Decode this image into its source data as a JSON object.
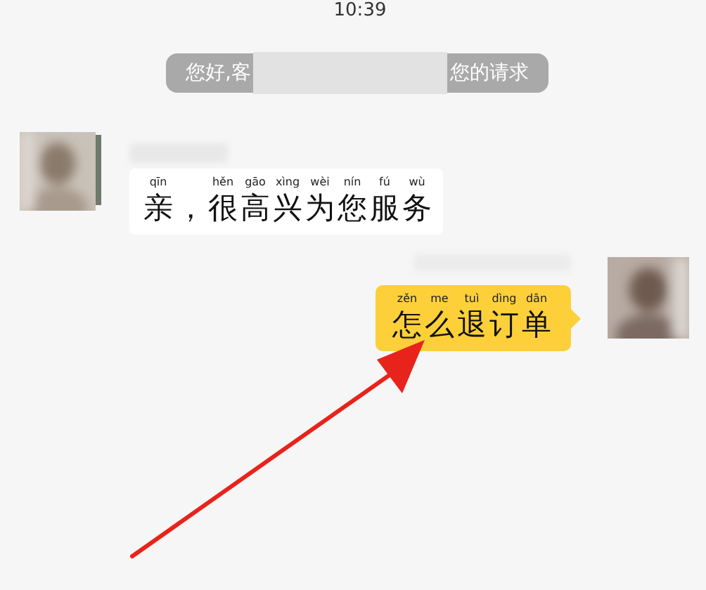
{
  "time": "10:39",
  "notice": {
    "parts": [
      "您好,客",
      "您的请求"
    ]
  },
  "messages": [
    {
      "kind": "received",
      "tokens": [
        {
          "char": "亲",
          "pinyin": "qīn"
        },
        {
          "char": "，"
        },
        {
          "char": "很",
          "pinyin": "hěn"
        },
        {
          "char": "高",
          "pinyin": "gāo"
        },
        {
          "char": "兴",
          "pinyin": "xìng"
        },
        {
          "char": "为",
          "pinyin": "wèi"
        },
        {
          "char": "您",
          "pinyin": "nín"
        },
        {
          "char": "服",
          "pinyin": "fú"
        },
        {
          "char": "务",
          "pinyin": "wù"
        }
      ]
    },
    {
      "kind": "sent",
      "tokens": [
        {
          "char": "怎",
          "pinyin": "zěn"
        },
        {
          "char": "么",
          "pinyin": "me"
        },
        {
          "char": "退",
          "pinyin": "tuì"
        },
        {
          "char": "订",
          "pinyin": "dìng"
        },
        {
          "char": "单",
          "pinyin": "dān"
        }
      ]
    }
  ]
}
